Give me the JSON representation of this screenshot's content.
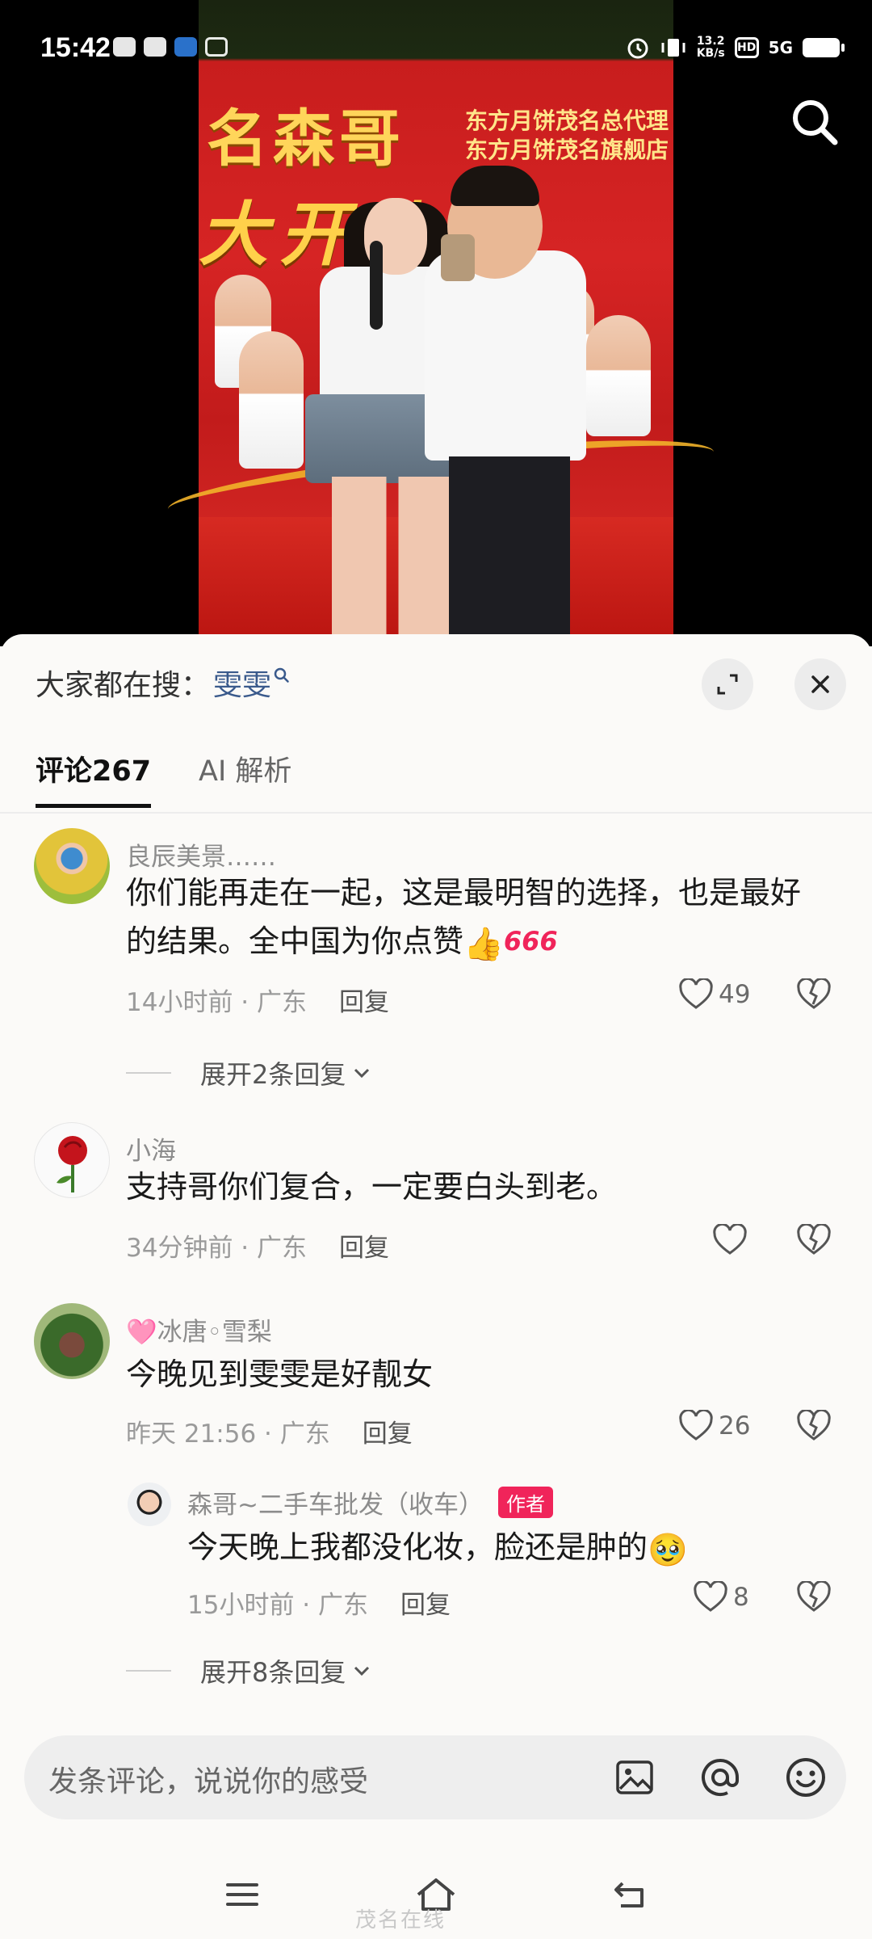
{
  "status_bar": {
    "time": "15:42",
    "net_speed": "13.2",
    "net_unit": "KB/s",
    "hd_label": "HD",
    "network": "5G"
  },
  "video": {
    "banner_name": "名森哥",
    "banner_line1": "东方月饼茂名总代理",
    "banner_line2": "东方月饼茂名旗舰店",
    "banner_big": "大开业"
  },
  "sheet": {
    "search_prefix": "大家都在搜：",
    "search_term": "雯雯",
    "tabs": [
      {
        "label": "评论267"
      },
      {
        "label": "AI 解析"
      }
    ]
  },
  "comments": [
    {
      "username": "良辰美景……",
      "text_main": "你们能再走在一起，这是最明智的选择，也是最好的结果。全中国为你点赞",
      "emoji_thumb": "👍",
      "emoji_666": "666",
      "time": "14小时前 · 广东",
      "reply_label": "回复",
      "likes": "49",
      "expand_label": "展开2条回复"
    },
    {
      "username": "小海",
      "text": "支持哥你们复合，一定要白头到老。",
      "time": "34分钟前 · 广东",
      "reply_label": "回复"
    },
    {
      "username": "🩷冰唐◦雪梨",
      "text": "今晚见到雯雯是好靓女",
      "time": "昨天 21:56 · 广东",
      "reply_label": "回复",
      "likes": "26",
      "reply": {
        "username": "森哥~二手车批发（收车）",
        "badge": "作者",
        "text": "今天晚上我都没化妆，脸还是肿的",
        "emoji": "🥹",
        "time": "15小时前 · 广东",
        "reply_label": "回复",
        "likes": "8"
      },
      "expand_label": "展开8条回复"
    }
  ],
  "input": {
    "placeholder": "发条评论，说说你的感受"
  },
  "watermark": "茂名在线"
}
